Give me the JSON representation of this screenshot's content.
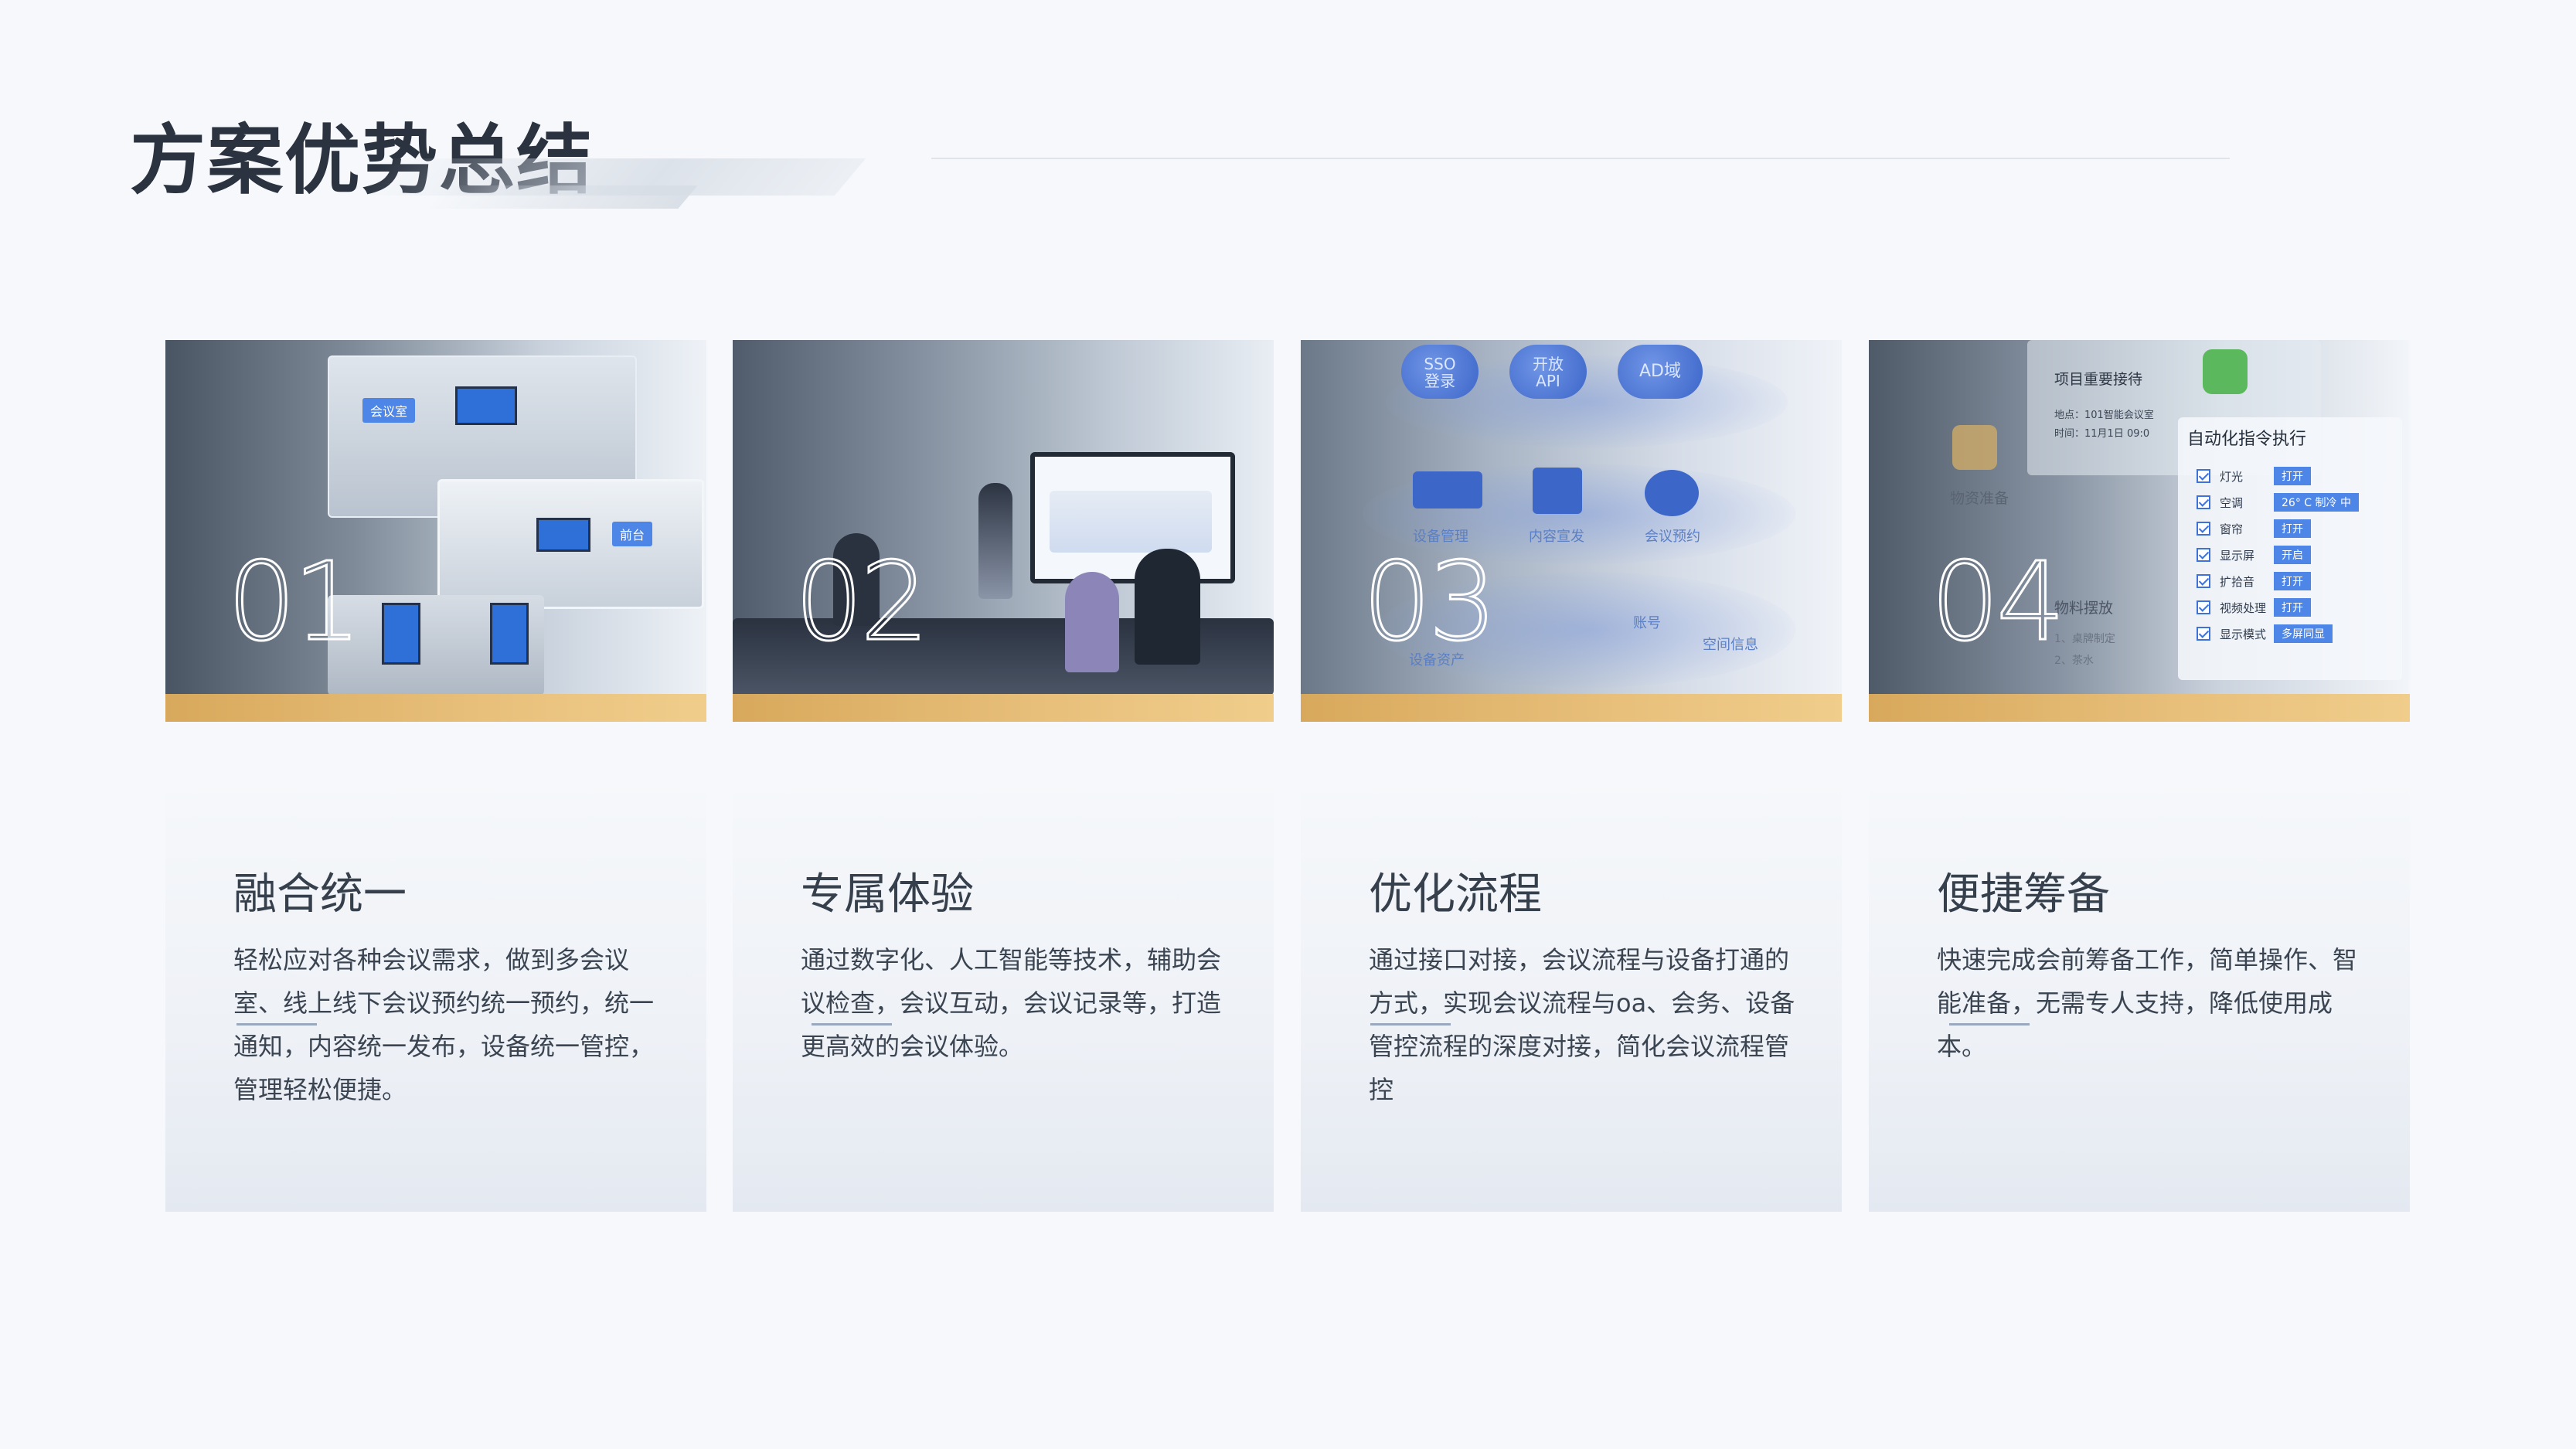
{
  "header": {
    "title": "方案优势总结"
  },
  "cards": [
    {
      "number": "01",
      "title": "融合统一",
      "desc": "轻松应对各种会议需求，做到多会议室、线上线下会议预约统一预约，统一通知，内容统一发布，设备统一管控，管理轻松便捷。",
      "image": {
        "tag1": "会议室",
        "tag2": "前台"
      }
    },
    {
      "number": "02",
      "title": "专属体验",
      "desc": "通过数字化、人工智能等技术，辅助会议检查，会议互动，会议记录等，打造更高效的会议体验。"
    },
    {
      "number": "03",
      "title": "优化流程",
      "desc": "通过接口对接，会议流程与设备打通的方式，实现会议流程与oa、会务、设备管控流程的深度对接，简化会议流程管控",
      "image": {
        "pills": [
          "SSO\n登录",
          "开放\nAPI",
          "AD域"
        ],
        "labels": [
          "设备管理",
          "内容宣发",
          "会议预约",
          "账号",
          "空间信息",
          "设备资产"
        ]
      }
    },
    {
      "number": "04",
      "title": "便捷筹备",
      "desc": "快速完成会前筹备工作，简单操作、智能准备，无需专人支持，降低使用成本。",
      "image": {
        "notice_title": "项目重要接待",
        "notice_place": "地点：101智能会议室",
        "notice_time": "时间：11月1日 09:0",
        "auto_title": "自动化指令执行",
        "left_a": "物资准备",
        "left_b": "物料摆放",
        "left_b1": "1、桌牌制定",
        "left_b2": "2、茶水",
        "commands": [
          {
            "name": "灯光",
            "state": "打开"
          },
          {
            "name": "空调",
            "state": "26° C 制冷 中"
          },
          {
            "name": "窗帘",
            "state": "打开"
          },
          {
            "name": "显示屏",
            "state": "开启"
          },
          {
            "name": "扩拾音",
            "state": "打开"
          },
          {
            "name": "视频处理",
            "state": "打开"
          },
          {
            "name": "显示模式",
            "state": "多屏同显"
          }
        ]
      }
    }
  ],
  "colors": {
    "accent_bar": "#e8c07c",
    "title": "#2b3340",
    "underline": "#9aa8bd"
  }
}
